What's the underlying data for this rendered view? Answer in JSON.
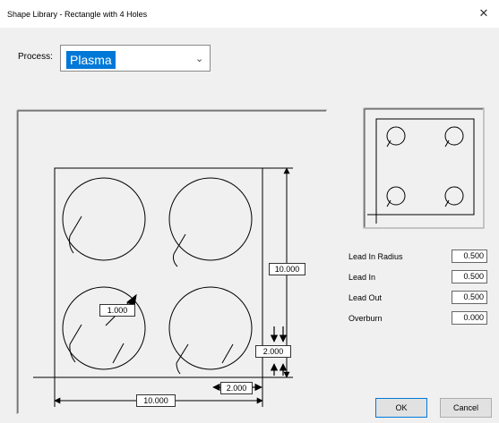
{
  "window": {
    "title": "Shape Library - Rectangle with 4 Holes",
    "close_glyph": "✕"
  },
  "process": {
    "label": "Process:",
    "value": "Plasma",
    "chevron": "⌄"
  },
  "drawing": {
    "width": "10.000",
    "height": "10.000",
    "hole_diameter": "1.000",
    "offset_x": "2.000",
    "offset_y": "2.000"
  },
  "fields": [
    {
      "label": "Lead In Radius",
      "value": "0.500"
    },
    {
      "label": "Lead In",
      "value": "0.500"
    },
    {
      "label": "Lead Out",
      "value": "0.500"
    },
    {
      "label": "Overburn",
      "value": "0.000"
    }
  ],
  "buttons": {
    "ok": "OK",
    "cancel": "Cancel"
  },
  "icons": {
    "close": "close-icon",
    "chevron": "chevron-down-icon"
  }
}
